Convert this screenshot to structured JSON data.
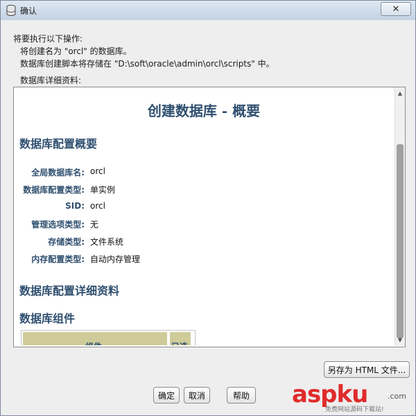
{
  "window": {
    "title": "确认",
    "close_label": "✕"
  },
  "intro": {
    "line1": "将要执行以下操作:",
    "line2": "将创建名为 \"orcl\" 的数据库。",
    "line3": "数据库创建脚本将存储在 \"D:\\soft\\oracle\\admin\\orcl\\scripts\" 中。",
    "details_label": "数据库详细资料:"
  },
  "document": {
    "title": "创建数据库 - 概要",
    "section_summary": "数据库配置概要",
    "fields": [
      {
        "label": "全局数据库名:",
        "value": "orcl"
      },
      {
        "label": "数据库配置类型:",
        "value": "单实例"
      },
      {
        "label": "SID:",
        "value": "orcl"
      },
      {
        "label": "管理选项类型:",
        "value": "无"
      },
      {
        "label": "存储类型:",
        "value": "文件系统"
      },
      {
        "label": "内存配置类型:",
        "value": "自动内存管理"
      }
    ],
    "section_details": "数据库配置详细资料",
    "section_components": "数据库组件",
    "table_headers": [
      "组件",
      "已选"
    ]
  },
  "buttons": {
    "save_html": "另存为 HTML 文件...",
    "ok": "确定",
    "cancel": "取消",
    "help": "帮助"
  },
  "watermark": {
    "brand": "aspku",
    "suffix": ".com",
    "tagline": "免费网站源码下载站!"
  },
  "colors": {
    "heading": "#2f4f6f",
    "table_header": "#cfcc9a",
    "watermark": "#e02b2b"
  }
}
